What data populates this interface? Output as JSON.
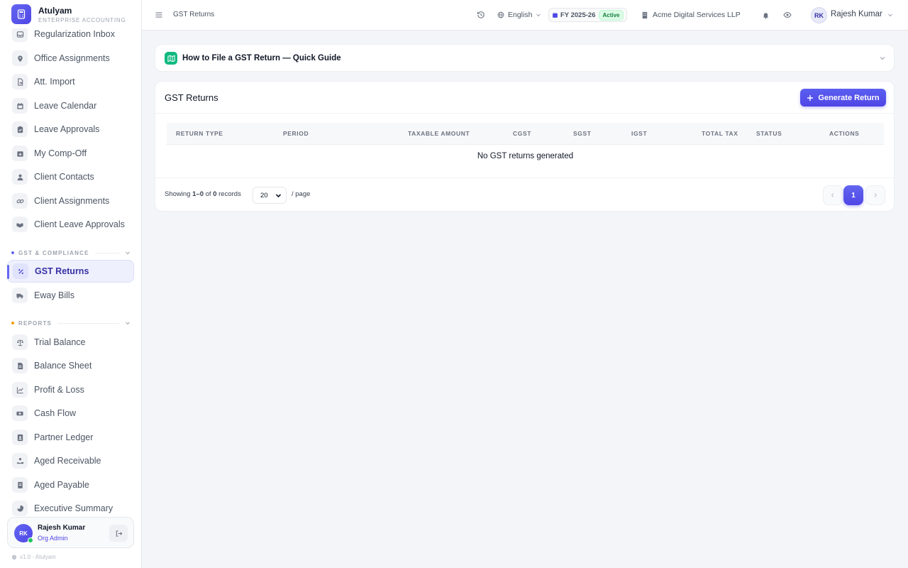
{
  "brand": {
    "name": "Atulyam",
    "subtitle": "ENTERPRISE ACCOUNTING"
  },
  "sidebar": {
    "items_top": [
      {
        "label": "Regularization Inbox",
        "icon": "inbox-icon"
      },
      {
        "label": "Office Assignments",
        "icon": "map-pin-icon"
      },
      {
        "label": "Att. Import",
        "icon": "file-import-icon"
      },
      {
        "label": "Leave Calendar",
        "icon": "calendar-icon"
      },
      {
        "label": "Leave Approvals",
        "icon": "clipboard-check-icon"
      },
      {
        "label": "My Comp-Off",
        "icon": "calendar-plus-icon"
      },
      {
        "label": "Client Contacts",
        "icon": "user-icon"
      },
      {
        "label": "Client Assignments",
        "icon": "link-icon"
      },
      {
        "label": "Client Leave Approvals",
        "icon": "handshake-icon"
      }
    ],
    "section_gst": {
      "label": "GST & COMPLIANCE",
      "color": "#6366f1"
    },
    "items_gst": [
      {
        "label": "GST Returns",
        "icon": "percent-icon",
        "active": true
      },
      {
        "label": "Eway Bills",
        "icon": "truck-icon"
      }
    ],
    "section_reports": {
      "label": "REPORTS",
      "color": "#f59e0b"
    },
    "items_reports": [
      {
        "label": "Trial Balance",
        "icon": "scale-icon"
      },
      {
        "label": "Balance Sheet",
        "icon": "document-icon"
      },
      {
        "label": "Profit & Loss",
        "icon": "chart-line-icon"
      },
      {
        "label": "Cash Flow",
        "icon": "cash-icon"
      },
      {
        "label": "Partner Ledger",
        "icon": "contact-card-icon"
      },
      {
        "label": "Aged Receivable",
        "icon": "hand-coin-icon"
      },
      {
        "label": "Aged Payable",
        "icon": "receipt-icon"
      },
      {
        "label": "Executive Summary",
        "icon": "pie-chart-icon"
      }
    ],
    "user": {
      "initials": "RK",
      "name": "Rajesh Kumar",
      "role": "Org Admin"
    },
    "version": "v1.0 · Atulyam"
  },
  "topbar": {
    "breadcrumb": "GST Returns",
    "language": "English",
    "fy_label": "FY 2025-26",
    "fy_status": "Active",
    "company": "Acme Digital Services LLP",
    "user_initials": "RK",
    "user_name": "Rajesh Kumar"
  },
  "guide": {
    "title": "How to File a GST Return — Quick Guide"
  },
  "main": {
    "title": "GST Returns",
    "generate_label": "Generate Return",
    "columns": [
      "RETURN TYPE",
      "PERIOD",
      "TAXABLE AMOUNT",
      "CGST",
      "SGST",
      "IGST",
      "TOTAL TAX",
      "STATUS",
      "ACTIONS"
    ],
    "empty_message": "No GST returns generated",
    "footer": {
      "showing_prefix": "Showing",
      "range_start": "1",
      "range_sep": "–",
      "range_end": "0",
      "of": "of",
      "total": "0",
      "records": "records",
      "per_page": "20",
      "per_page_label": "/ page"
    },
    "pagination": {
      "current_page": "1"
    }
  },
  "colors": {
    "accent": "#4f46e5",
    "active_green": "#15803d",
    "guide_icon": "#10b981"
  }
}
